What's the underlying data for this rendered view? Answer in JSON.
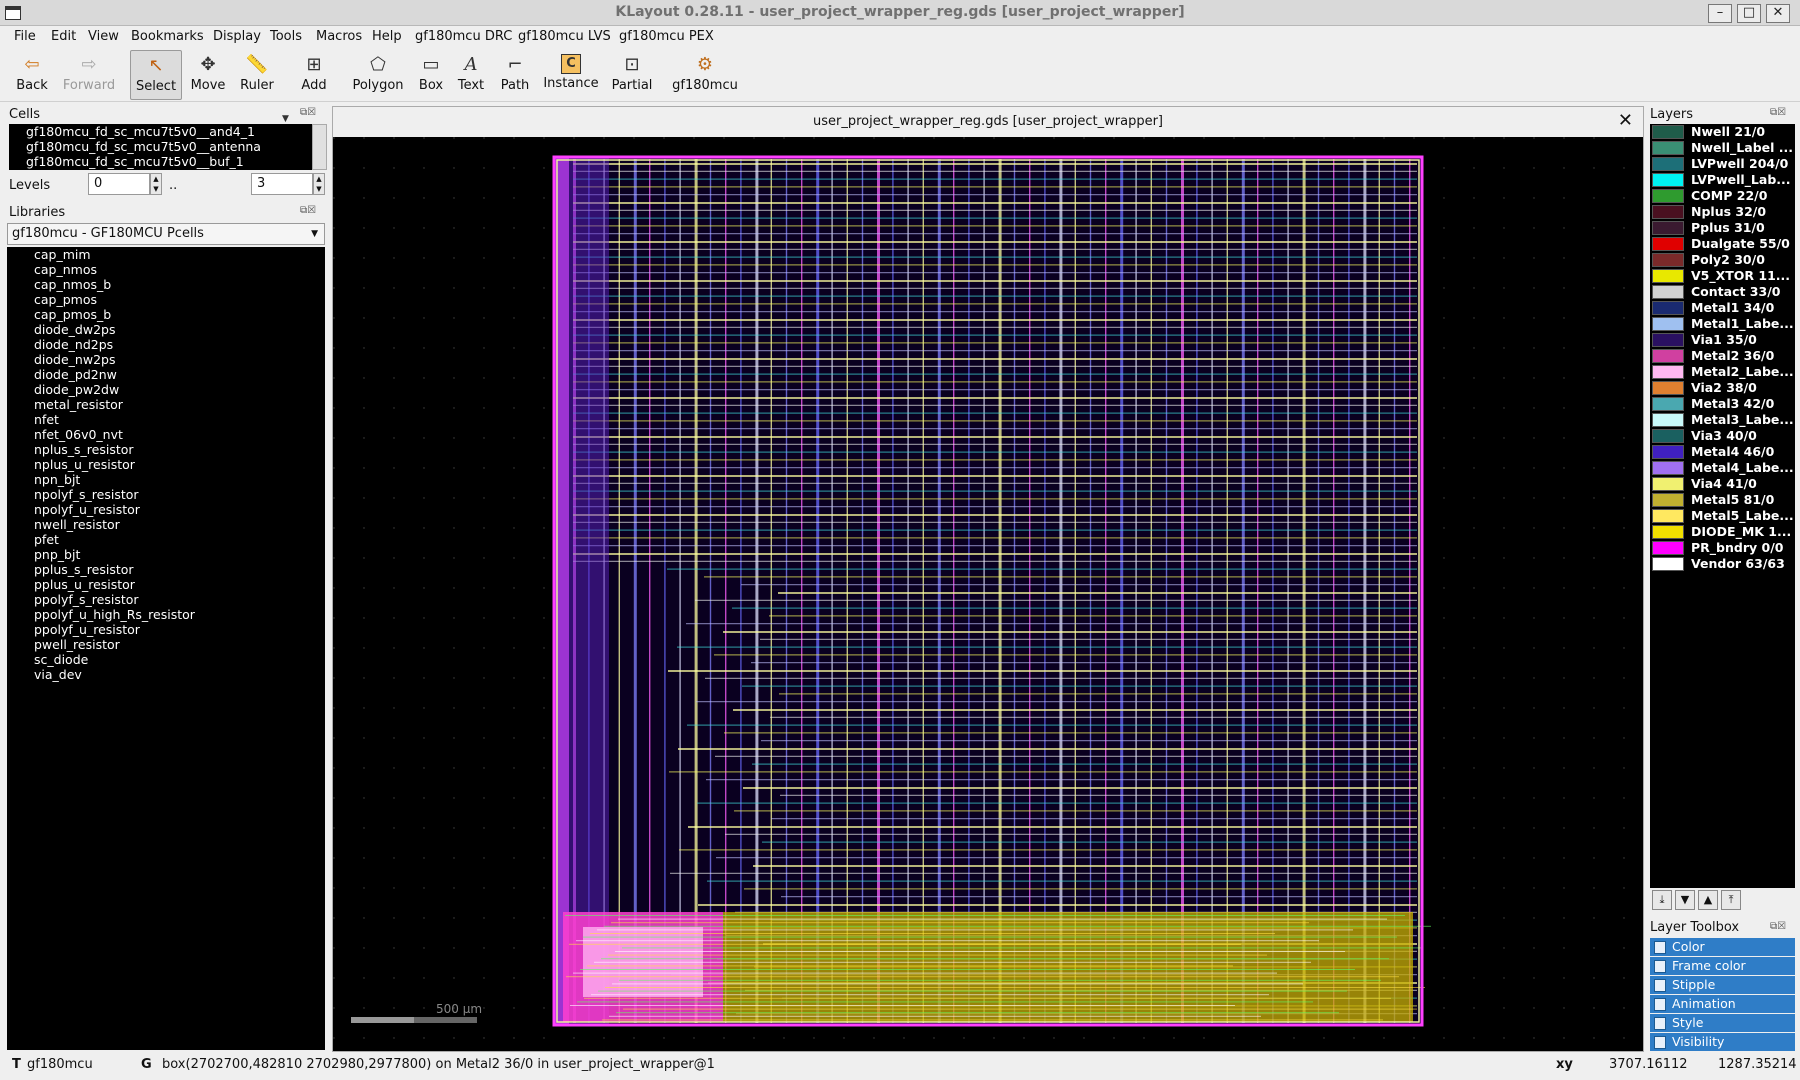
{
  "window": {
    "title": "KLayout 0.28.11 - user_project_wrapper_reg.gds [user_project_wrapper]"
  },
  "menu": [
    "File",
    "Edit",
    "View",
    "Bookmarks",
    "Display",
    "Tools",
    "Macros",
    "Help",
    "gf180mcu DRC",
    "gf180mcu LVS",
    "gf180mcu PEX"
  ],
  "toolbar": {
    "back": "Back",
    "forward": "Forward",
    "select": "Select",
    "move": "Move",
    "ruler": "Ruler",
    "add": "Add",
    "polygon": "Polygon",
    "box": "Box",
    "text": "Text",
    "path": "Path",
    "instance": "Instance",
    "partial": "Partial",
    "gf180mcu": "gf180mcu"
  },
  "cells": {
    "title": "Cells",
    "items": [
      "gf180mcu_fd_sc_mcu7t5v0__and4_1",
      "gf180mcu_fd_sc_mcu7t5v0__antenna",
      "gf180mcu_fd_sc_mcu7t5v0__buf_1"
    ],
    "levels_label": "Levels",
    "level_from": "0",
    "level_sep": "..",
    "level_to": "3"
  },
  "libraries": {
    "title": "Libraries",
    "selected": "gf180mcu - GF180MCU Pcells",
    "items": [
      "cap_mim",
      "cap_nmos",
      "cap_nmos_b",
      "cap_pmos",
      "cap_pmos_b",
      "diode_dw2ps",
      "diode_nd2ps",
      "diode_nw2ps",
      "diode_pd2nw",
      "diode_pw2dw",
      "metal_resistor",
      "nfet",
      "nfet_06v0_nvt",
      "nplus_s_resistor",
      "nplus_u_resistor",
      "npn_bjt",
      "npolyf_s_resistor",
      "npolyf_u_resistor",
      "nwell_resistor",
      "pfet",
      "pnp_bjt",
      "pplus_s_resistor",
      "pplus_u_resistor",
      "ppolyf_s_resistor",
      "ppolyf_u_high_Rs_resistor",
      "ppolyf_u_resistor",
      "pwell_resistor",
      "sc_diode",
      "via_dev"
    ]
  },
  "view": {
    "tab_title": "user_project_wrapper_reg.gds [user_project_wrapper]",
    "scale_label": "500 µm"
  },
  "layers": {
    "title": "Layers",
    "items": [
      {
        "name": "Nwell 21/0",
        "color": "#1f5c4a"
      },
      {
        "name": "Nwell_Label ...",
        "color": "#3a8f74"
      },
      {
        "name": "LVPwell 204/0",
        "color": "#1d6f78"
      },
      {
        "name": "LVPwell_Lab...",
        "color": "#00f2f2"
      },
      {
        "name": "COMP 22/0",
        "color": "#2f9b2f"
      },
      {
        "name": "Nplus 32/0",
        "color": "#4a1020"
      },
      {
        "name": "Pplus 31/0",
        "color": "#3a1a30"
      },
      {
        "name": "Dualgate 55/0",
        "color": "#e00000"
      },
      {
        "name": "Poly2 30/0",
        "color": "#7a2a2a"
      },
      {
        "name": "V5_XTOR 11...",
        "color": "#e8e800"
      },
      {
        "name": "Contact 33/0",
        "color": "#d0d0d0"
      },
      {
        "name": "Metal1 34/0",
        "color": "#1a2a70"
      },
      {
        "name": "Metal1_Labe...",
        "color": "#9fc0f0"
      },
      {
        "name": "Via1 35/0",
        "color": "#2a1060"
      },
      {
        "name": "Metal2 36/0",
        "color": "#d040a0"
      },
      {
        "name": "Metal2_Labe...",
        "color": "#ffb8f0"
      },
      {
        "name": "Via2 38/0",
        "color": "#e08030"
      },
      {
        "name": "Metal3 42/0",
        "color": "#4aa8b0"
      },
      {
        "name": "Metal3_Labe...",
        "color": "#c8f8f8"
      },
      {
        "name": "Via3 40/0",
        "color": "#1a6060"
      },
      {
        "name": "Metal4 46/0",
        "color": "#4020c0"
      },
      {
        "name": "Metal4_Labe...",
        "color": "#a070f0"
      },
      {
        "name": "Via4 41/0",
        "color": "#f0f070"
      },
      {
        "name": "Metal5 81/0",
        "color": "#c0b030"
      },
      {
        "name": "Metal5_Labe...",
        "color": "#ffe860"
      },
      {
        "name": "DIODE_MK 1...",
        "color": "#f0e000"
      },
      {
        "name": "PR_bndry 0/0",
        "color": "#ff00ff"
      },
      {
        "name": "Vendor 63/63",
        "color": "#ffffff"
      }
    ]
  },
  "toolbox": {
    "title": "Layer Toolbox",
    "items": [
      "Color",
      "Frame color",
      "Stipple",
      "Animation",
      "Style",
      "Visibility"
    ]
  },
  "status": {
    "mode_key": "T",
    "mode": "gf180mcu",
    "grid_key": "G",
    "message": "box(2702700,482810 2702980,2977800) on Metal2 36/0 in user_project_wrapper@1",
    "coord_key": "xy",
    "x": "3707.16112",
    "y": "1287.35214"
  }
}
